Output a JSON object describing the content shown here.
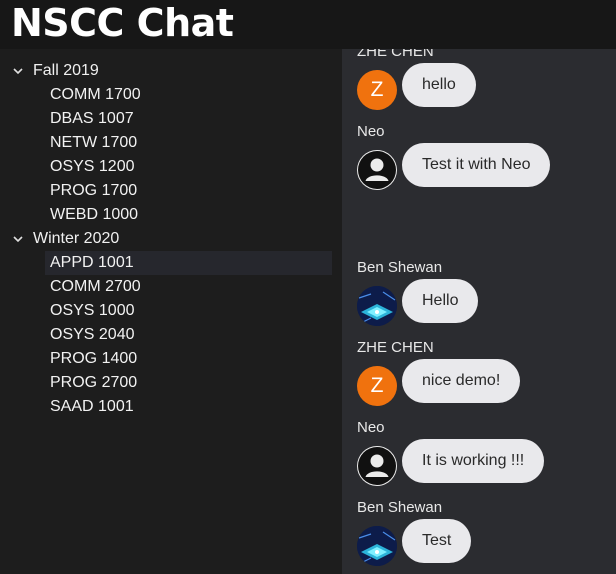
{
  "app": {
    "title": "NSCC Chat"
  },
  "sidebar": {
    "terms": [
      {
        "label": "Fall 2019",
        "courses": [
          "COMM 1700",
          "DBAS 1007",
          "NETW 1700",
          "OSYS 1200",
          "PROG 1700",
          "WEBD 1000"
        ]
      },
      {
        "label": "Winter 2020",
        "courses": [
          "APPD 1001",
          "COMM 2700",
          "OSYS 1000",
          "OSYS 2040",
          "PROG 1400",
          "PROG 2700",
          "SAAD 1001"
        ]
      }
    ],
    "selected_course": "APPD 1001"
  },
  "chat": {
    "messages": [
      {
        "sender": "ZHE CHEN",
        "avatar_letter": "Z",
        "avatar_color": "#f0720e",
        "text": "hello"
      },
      {
        "sender": "Neo",
        "text": "Test it with Neo"
      },
      {
        "sender": "Ben Shewan",
        "text": "Hello"
      },
      {
        "sender": "ZHE CHEN",
        "avatar_letter": "Z",
        "avatar_color": "#f0720e",
        "text": "nice demo!"
      },
      {
        "sender": "Neo",
        "text": "It is working !!!"
      },
      {
        "sender": "Ben Shewan",
        "text": "Test"
      }
    ]
  }
}
